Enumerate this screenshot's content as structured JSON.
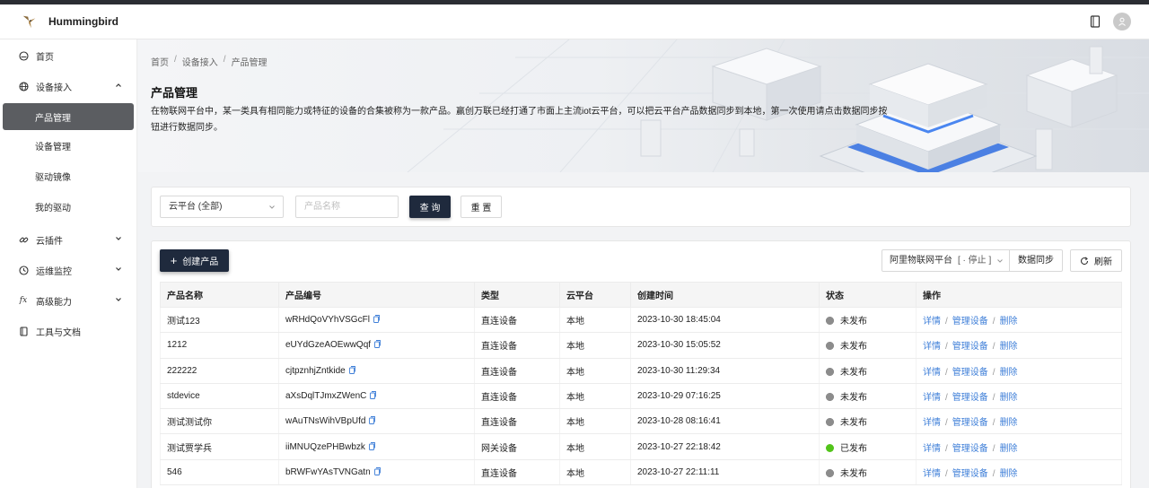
{
  "app": {
    "brand": "Hummingbird"
  },
  "header": {
    "doc_icon": "document-icon",
    "avatar_icon": "user-icon"
  },
  "sidebar": {
    "items": [
      {
        "label": "首页",
        "icon": "home-icon"
      },
      {
        "label": "设备接入",
        "icon": "globe-icon",
        "expanded": true,
        "children": [
          {
            "label": "产品管理",
            "active": true
          },
          {
            "label": "设备管理"
          },
          {
            "label": "驱动镜像"
          },
          {
            "label": "我的驱动"
          }
        ]
      },
      {
        "label": "云插件",
        "icon": "link-icon"
      },
      {
        "label": "运维监控",
        "icon": "monitor-icon"
      },
      {
        "label": "高级能力",
        "icon": "fx-icon"
      },
      {
        "label": "工具与文档",
        "icon": "book-icon"
      }
    ]
  },
  "breadcrumb": [
    "首页",
    "设备接入",
    "产品管理"
  ],
  "page": {
    "title": "产品管理",
    "description": "在物联网平台中，某一类具有相同能力或特征的设备的合集被称为一款产品。赢创万联已经打通了市面上主流iot云平台，可以把云平台产品数据同步到本地，第一次使用请点击数据同步按钮进行数据同步。"
  },
  "filter": {
    "platform_select": "云平台 (全部)",
    "name_placeholder": "产品名称",
    "query_label": "查 询",
    "reset_label": "重 置"
  },
  "toolbar": {
    "create_label": "创建产品",
    "platform_label": "阿里物联网平台",
    "platform_status": "[ · 停止 ]",
    "sync_label": "数据同步",
    "refresh_label": "刷新"
  },
  "table": {
    "columns": [
      "产品名称",
      "产品编号",
      "类型",
      "云平台",
      "创建时间",
      "状态",
      "操作"
    ],
    "rows": [
      {
        "name": "测试123",
        "code": "wRHdQoVYhVSGcFl",
        "type": "直连设备",
        "platform": "本地",
        "created": "2023-10-30 18:45:04",
        "status": "未发布",
        "published": false
      },
      {
        "name": "1212",
        "code": "eUYdGzeAOEwwQqf",
        "type": "直连设备",
        "platform": "本地",
        "created": "2023-10-30 15:05:52",
        "status": "未发布",
        "published": false
      },
      {
        "name": "222222",
        "code": "cjtpznhjZntkide",
        "type": "直连设备",
        "platform": "本地",
        "created": "2023-10-30 11:29:34",
        "status": "未发布",
        "published": false
      },
      {
        "name": "stdevice",
        "code": "aXsDqlTJmxZWenC",
        "type": "直连设备",
        "platform": "本地",
        "created": "2023-10-29 07:16:25",
        "status": "未发布",
        "published": false
      },
      {
        "name": "测试测试你",
        "code": "wAuTNsWihVBpUfd",
        "type": "直连设备",
        "platform": "本地",
        "created": "2023-10-28 08:16:41",
        "status": "未发布",
        "published": false
      },
      {
        "name": "测试贾学兵",
        "code": "iiMNUQzePHBwbzk",
        "type": "网关设备",
        "platform": "本地",
        "created": "2023-10-27 22:18:42",
        "status": "已发布",
        "published": true
      },
      {
        "name": "546",
        "code": "bRWFwYAsTVNGatn",
        "type": "直连设备",
        "platform": "本地",
        "created": "2023-10-27 22:11:11",
        "status": "未发布",
        "published": false
      }
    ],
    "actions": {
      "detail": "详情",
      "manage": "管理设备",
      "delete": "删除",
      "separator": "/"
    }
  },
  "colors": {
    "primary_dark": "#1f2a3d",
    "link": "#3f7fd8",
    "published": "#52c41a",
    "unpublished": "#8c8c8c",
    "active_menu": "#5b5d61"
  }
}
